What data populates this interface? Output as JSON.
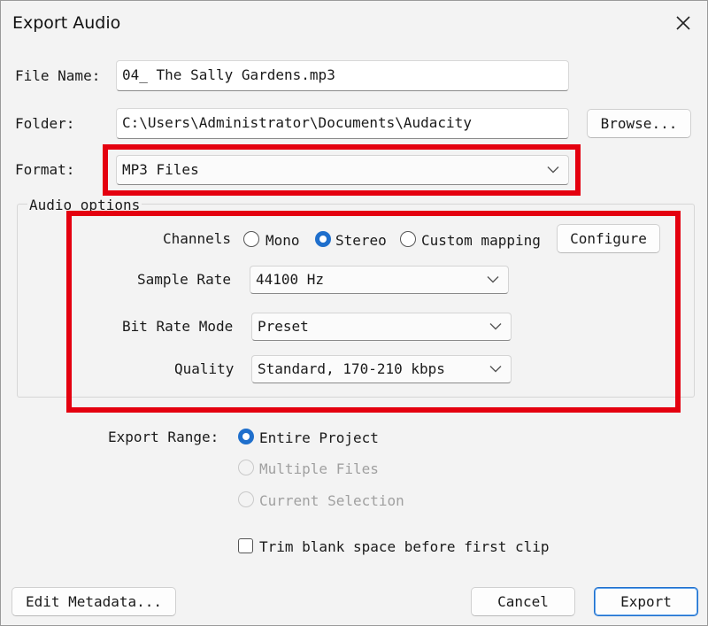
{
  "window": {
    "title": "Export Audio",
    "close_icon": "close-icon"
  },
  "file": {
    "name_label": "File Name:",
    "name_value": "04_ The Sally Gardens.mp3",
    "folder_label": "Folder:",
    "folder_value": "C:\\Users\\Administrator\\Documents\\Audacity",
    "browse_label": "Browse..."
  },
  "format": {
    "label": "Format:",
    "value": "MP3 Files"
  },
  "audio_options": {
    "group_label": "Audio options",
    "channels_label": "Channels",
    "channels": [
      {
        "label": "Mono",
        "checked": false
      },
      {
        "label": "Stereo",
        "checked": true
      },
      {
        "label": "Custom mapping",
        "checked": false
      }
    ],
    "configure_label": "Configure",
    "sample_rate_label": "Sample Rate",
    "sample_rate_value": "44100 Hz",
    "bit_rate_mode_label": "Bit Rate Mode",
    "bit_rate_mode_value": "Preset",
    "quality_label": "Quality",
    "quality_value": "Standard, 170-210 kbps"
  },
  "export_range": {
    "label": "Export Range:",
    "options": [
      {
        "label": "Entire Project",
        "checked": true,
        "enabled": true
      },
      {
        "label": "Multiple Files",
        "checked": false,
        "enabled": false
      },
      {
        "label": "Current Selection",
        "checked": false,
        "enabled": false
      }
    ]
  },
  "trim": {
    "label": "Trim blank space before first clip",
    "checked": false
  },
  "footer": {
    "edit_metadata_label": "Edit Metadata...",
    "cancel_label": "Cancel",
    "export_label": "Export"
  },
  "colors": {
    "accent": "#1f6fcc",
    "highlight": "#e4000f",
    "background": "#f3f3f3"
  }
}
